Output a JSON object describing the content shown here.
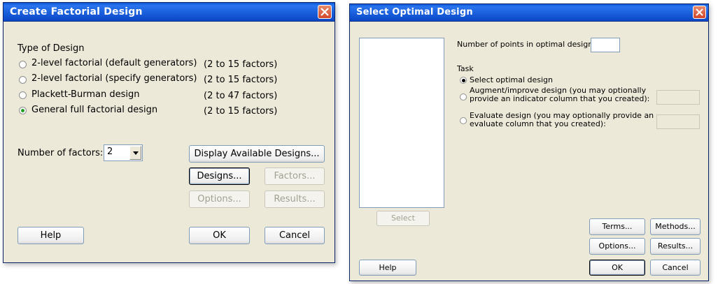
{
  "factorial_dialog": {
    "title": "Create Factorial Design",
    "type_of_design_label": "Type of Design",
    "options": [
      {
        "label": "2-level factorial (default generators)",
        "range": "(2 to 15 factors)",
        "selected": false
      },
      {
        "label": "2-level factorial (specify generators)",
        "range": "(2 to 15 factors)",
        "selected": false
      },
      {
        "label": "Plackett-Burman design",
        "range": "(2 to 47 factors)",
        "selected": false
      },
      {
        "label": "General full factorial design",
        "range": "(2 to 15 factors)",
        "selected": true
      }
    ],
    "number_of_factors_label": "Number of factors:",
    "number_of_factors_value": "2",
    "display_designs_label": "Display Available Designs...",
    "designs_label": "Designs...",
    "factors_label": "Factors...",
    "options_label": "Options...",
    "results_label": "Results...",
    "help_label": "Help",
    "ok_label": "OK",
    "cancel_label": "Cancel"
  },
  "optimal_dialog": {
    "title": "Select Optimal Design",
    "points_label": "Number of points in optimal design:",
    "points_value": "",
    "task_label": "Task",
    "task_select": "Select optimal design",
    "task_augment_line1": "Augment/improve design (you may optionally",
    "task_augment_line2": "provide an indicator column that you created):",
    "task_evaluate_line1": "Evaluate design (you may optionally provide an",
    "task_evaluate_line2": "evaluate column that you created):",
    "select_label": "Select",
    "terms_label": "Terms...",
    "methods_label": "Methods...",
    "options_label": "Options...",
    "results_label": "Results...",
    "help_label": "Help",
    "ok_label": "OK",
    "cancel_label": "Cancel"
  },
  "colors": {
    "title_bar": "#1a5fdc",
    "dialog_face": "#ece9d8",
    "close_button": "#d2462a",
    "radio_dot": "#21a121"
  },
  "icons": {
    "close": "close-icon",
    "dropdown": "chevron-down-icon"
  }
}
